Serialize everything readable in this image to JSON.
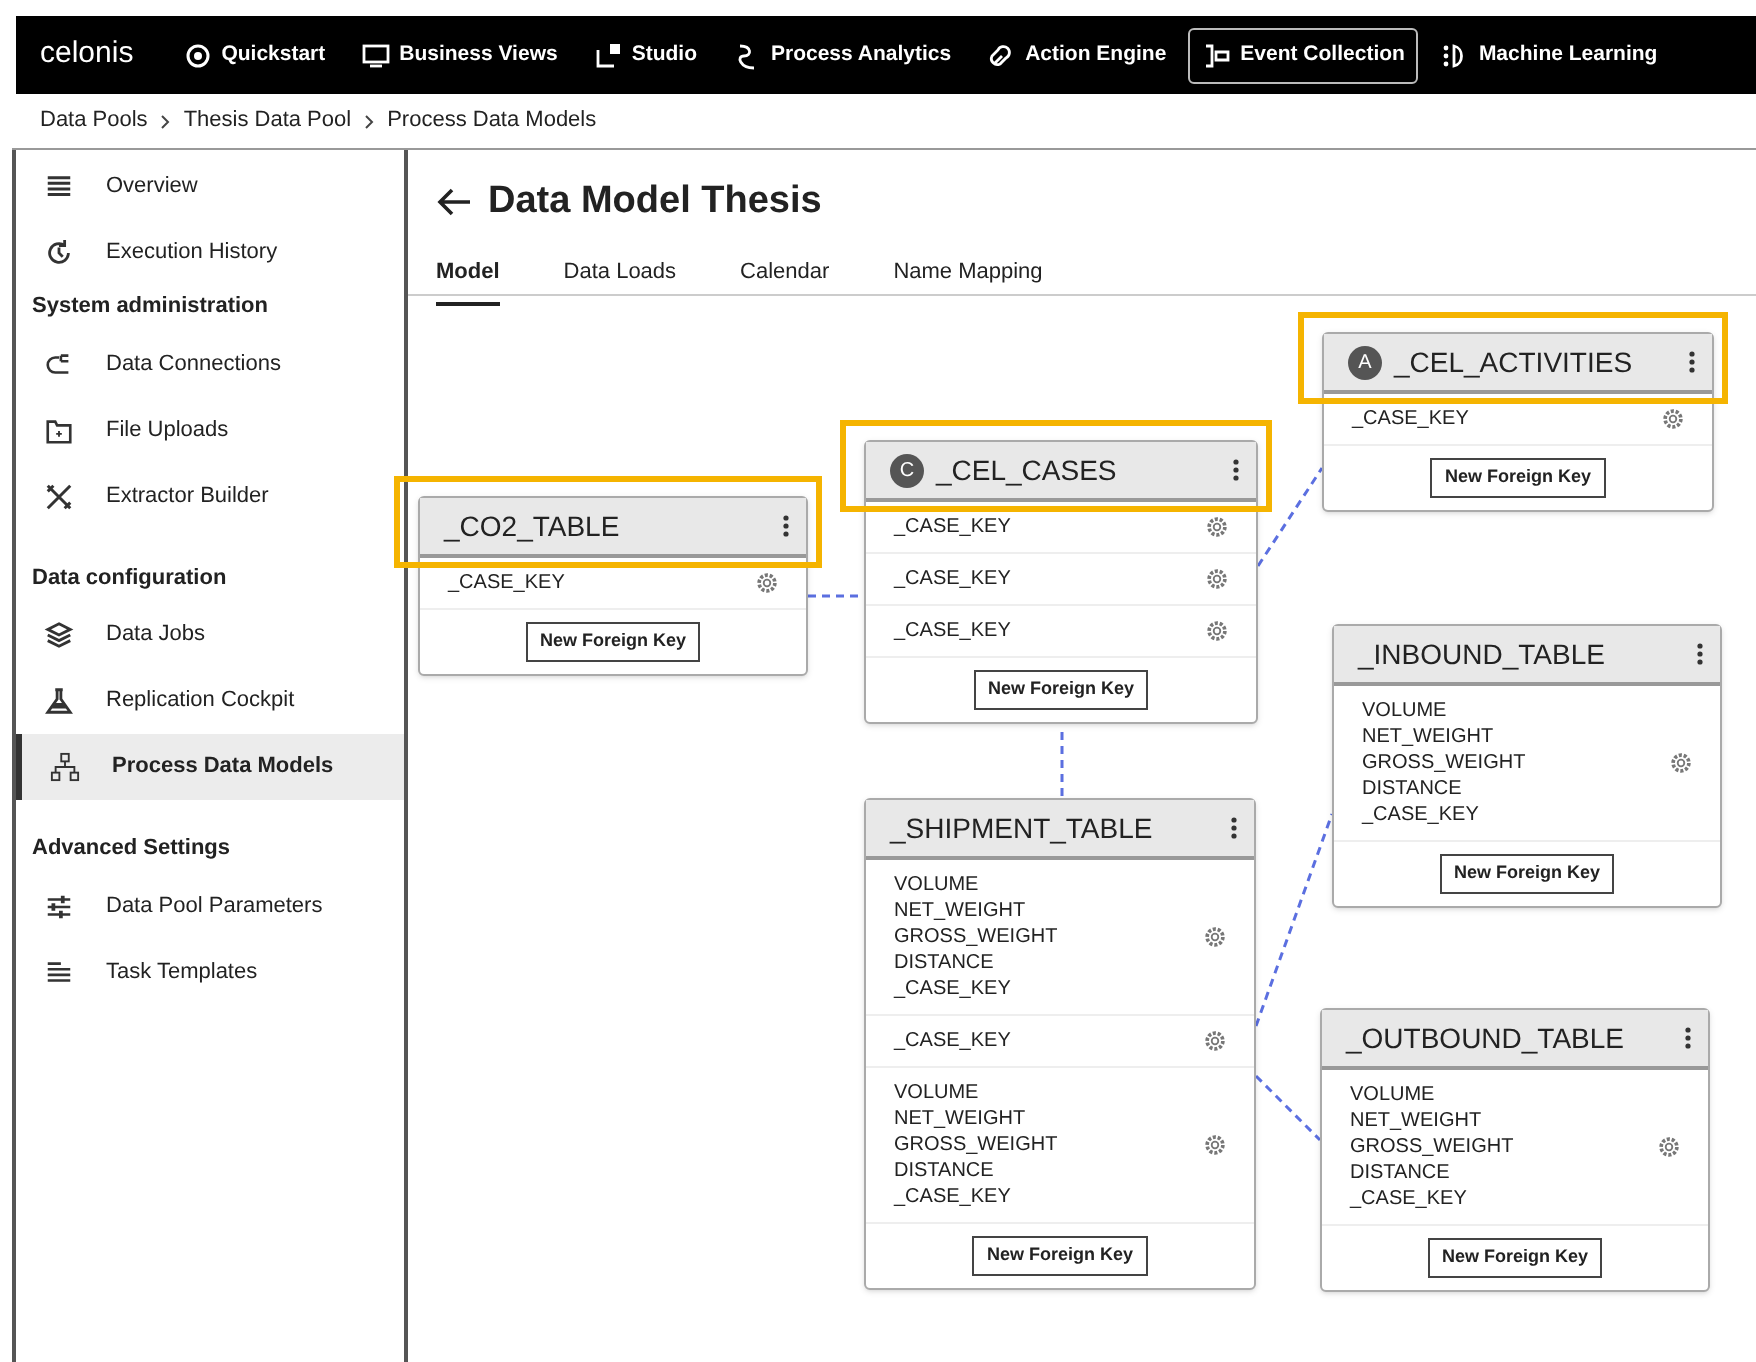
{
  "top_nav": {
    "logo": "celonis",
    "items": [
      {
        "label": "Quickstart",
        "selected": false
      },
      {
        "label": "Business Views",
        "selected": false
      },
      {
        "label": "Studio",
        "selected": false
      },
      {
        "label": "Process Analytics",
        "selected": false
      },
      {
        "label": "Action Engine",
        "selected": false
      },
      {
        "label": "Event Collection",
        "selected": true
      },
      {
        "label": "Machine Learning",
        "selected": false
      }
    ]
  },
  "breadcrumb": [
    "Data Pools",
    "Thesis Data Pool",
    "Process Data Models"
  ],
  "sidebar": {
    "sections": [
      {
        "items": [
          {
            "label": "Overview",
            "selected": false
          },
          {
            "label": "Execution History",
            "selected": false
          }
        ]
      },
      {
        "heading": "System administration",
        "items": [
          {
            "label": "Data Connections",
            "selected": false
          },
          {
            "label": "File Uploads",
            "selected": false
          },
          {
            "label": "Extractor Builder",
            "selected": false
          }
        ]
      },
      {
        "heading": "Data configuration",
        "items": [
          {
            "label": "Data Jobs",
            "selected": false
          },
          {
            "label": "Replication Cockpit",
            "selected": false
          },
          {
            "label": "Process Data Models",
            "selected": true
          }
        ]
      },
      {
        "heading": "Advanced Settings",
        "items": [
          {
            "label": "Data Pool Parameters",
            "selected": false
          },
          {
            "label": "Task Templates",
            "selected": false
          }
        ]
      }
    ]
  },
  "page": {
    "title": "Data Model Thesis",
    "tabs": [
      {
        "label": "Model",
        "selected": true
      },
      {
        "label": "Data Loads",
        "selected": false
      },
      {
        "label": "Calendar",
        "selected": false
      },
      {
        "label": "Name Mapping",
        "selected": false
      }
    ]
  },
  "tables": [
    {
      "name": "_CO2_TABLE",
      "highlighted": true,
      "rows": [
        {
          "fields": [
            "_CASE_KEY"
          ]
        }
      ],
      "button": "New Foreign Key"
    },
    {
      "name": "_CEL_CASES",
      "badge": "C",
      "highlighted": true,
      "rows": [
        {
          "fields": [
            "_CASE_KEY"
          ]
        },
        {
          "fields": [
            "_CASE_KEY"
          ]
        },
        {
          "fields": [
            "_CASE_KEY"
          ]
        }
      ],
      "button": "New Foreign Key"
    },
    {
      "name": "_CEL_ACTIVITIES",
      "badge": "A",
      "highlighted": true,
      "rows": [
        {
          "fields": [
            "_CASE_KEY"
          ]
        }
      ],
      "button": "New Foreign Key"
    },
    {
      "name": "_INBOUND_TABLE",
      "highlighted": false,
      "rows": [
        {
          "fields": [
            "VOLUME",
            "NET_WEIGHT",
            "GROSS_WEIGHT",
            "DISTANCE",
            "_CASE_KEY"
          ]
        }
      ],
      "button": "New Foreign Key"
    },
    {
      "name": "_SHIPMENT_TABLE",
      "highlighted": false,
      "rows": [
        {
          "fields": [
            "VOLUME",
            "NET_WEIGHT",
            "GROSS_WEIGHT",
            "DISTANCE",
            "_CASE_KEY"
          ]
        },
        {
          "fields": [
            "_CASE_KEY"
          ]
        },
        {
          "fields": [
            "VOLUME",
            "NET_WEIGHT",
            "GROSS_WEIGHT",
            "DISTANCE",
            "_CASE_KEY"
          ]
        }
      ],
      "button": "New Foreign Key"
    },
    {
      "name": "_OUTBOUND_TABLE",
      "highlighted": false,
      "rows": [
        {
          "fields": [
            "VOLUME",
            "NET_WEIGHT",
            "GROSS_WEIGHT",
            "DISTANCE",
            "_CASE_KEY"
          ]
        }
      ],
      "button": "New Foreign Key"
    }
  ]
}
